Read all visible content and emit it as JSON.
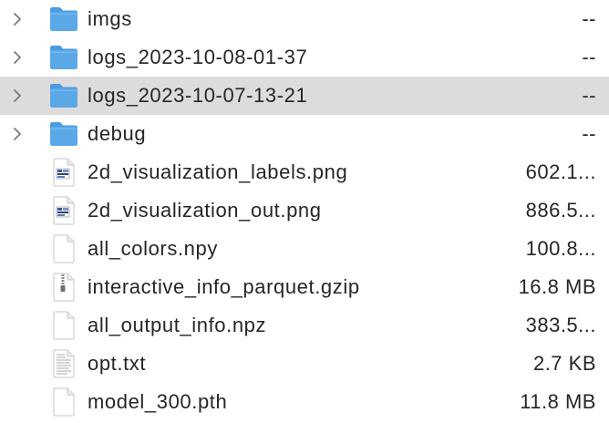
{
  "colors": {
    "folder": "#5aa9e6",
    "folder_tab": "#4a9be0",
    "selected_row": "#dcdcdc",
    "text": "#262626"
  },
  "rows": [
    {
      "name": "imgs",
      "size": "--",
      "kind": "folder",
      "icon": "folder-icon",
      "expandable": true,
      "selected": false
    },
    {
      "name": "logs_2023-10-08-01-37",
      "size": "--",
      "kind": "folder",
      "icon": "folder-icon",
      "expandable": true,
      "selected": false
    },
    {
      "name": "logs_2023-10-07-13-21",
      "size": "--",
      "kind": "folder",
      "icon": "folder-icon",
      "expandable": true,
      "selected": true
    },
    {
      "name": "debug",
      "size": "--",
      "kind": "folder",
      "icon": "folder-icon",
      "expandable": true,
      "selected": false
    },
    {
      "name": "2d_visualization_labels.png",
      "size": "602.1...",
      "kind": "image",
      "icon": "image-file-icon",
      "expandable": false,
      "selected": false
    },
    {
      "name": "2d_visualization_out.png",
      "size": "886.5...",
      "kind": "image",
      "icon": "image-file-icon",
      "expandable": false,
      "selected": false
    },
    {
      "name": "all_colors.npy",
      "size": "100.8...",
      "kind": "file",
      "icon": "document-icon",
      "expandable": false,
      "selected": false
    },
    {
      "name": "interactive_info_parquet.gzip",
      "size": "16.8 MB",
      "kind": "archive",
      "icon": "archive-file-icon",
      "expandable": false,
      "selected": false
    },
    {
      "name": "all_output_info.npz",
      "size": "383.5...",
      "kind": "file",
      "icon": "document-icon",
      "expandable": false,
      "selected": false
    },
    {
      "name": "opt.txt",
      "size": "2.7 KB",
      "kind": "text",
      "icon": "text-file-icon",
      "expandable": false,
      "selected": false
    },
    {
      "name": "model_300.pth",
      "size": "11.8 MB",
      "kind": "file",
      "icon": "document-icon",
      "expandable": false,
      "selected": false
    }
  ]
}
